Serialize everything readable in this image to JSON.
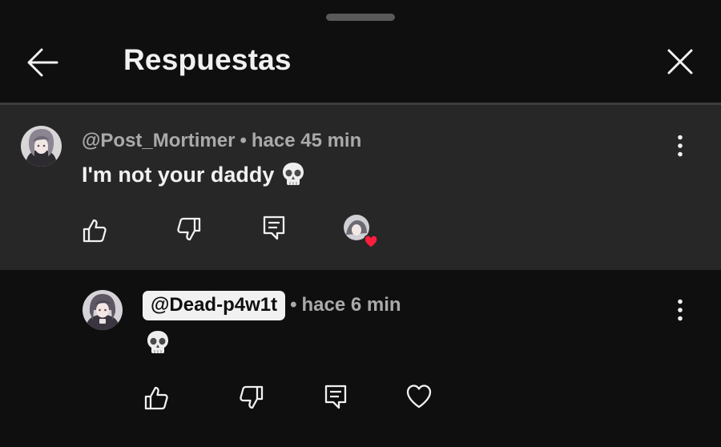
{
  "header": {
    "title": "Respuestas",
    "back_icon": "arrow-left-icon",
    "close_icon": "close-icon"
  },
  "parent": {
    "author": "@Post_Mortimer",
    "separator": "•",
    "time": "hace 45 min",
    "text": "I'm not your daddy",
    "emoji": "skull-emoji",
    "actions": [
      "like-icon",
      "dislike-icon",
      "reply-icon",
      "creator-heart-badge"
    ]
  },
  "reply": {
    "mention": "@Dead-p4w1t",
    "separator": "•",
    "time": "hace 6 min",
    "emoji": "skull-emoji",
    "actions": [
      "like-icon",
      "dislike-icon",
      "reply-icon",
      "heart-icon"
    ]
  },
  "colors": {
    "background": "#0f0f0f",
    "highlight": "#272727",
    "text": "#f1f1f1",
    "secondary_text": "#aaaaaa",
    "heart": "#ff1d3c"
  }
}
